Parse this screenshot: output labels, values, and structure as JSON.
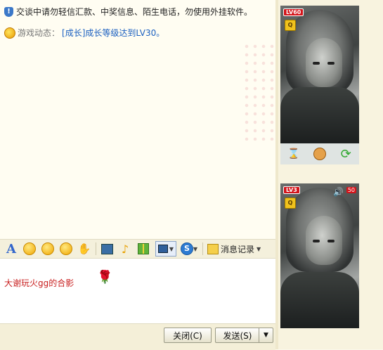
{
  "chat": {
    "notice": "交谈中请勿轻信汇款、中奖信息、陌生电话，勿使用外挂软件。",
    "game_status_label": "游戏动态：",
    "game_status_link": "[成长]成长等级达到LV30。"
  },
  "toolbar": {
    "history_label": "消息记录"
  },
  "input": {
    "text": "大谢玩火gg的合影",
    "emoji": "rose"
  },
  "buttons": {
    "close": "关闭(C)",
    "send": "发送(S)"
  },
  "avatars": {
    "top": {
      "level_badge": "LV60"
    },
    "bottom": {
      "level_badge": "LV3",
      "volume": "50"
    }
  },
  "colors": {
    "accent": "#1a5fc0",
    "input_text": "#c81e1e",
    "badge": "#d4141a"
  }
}
